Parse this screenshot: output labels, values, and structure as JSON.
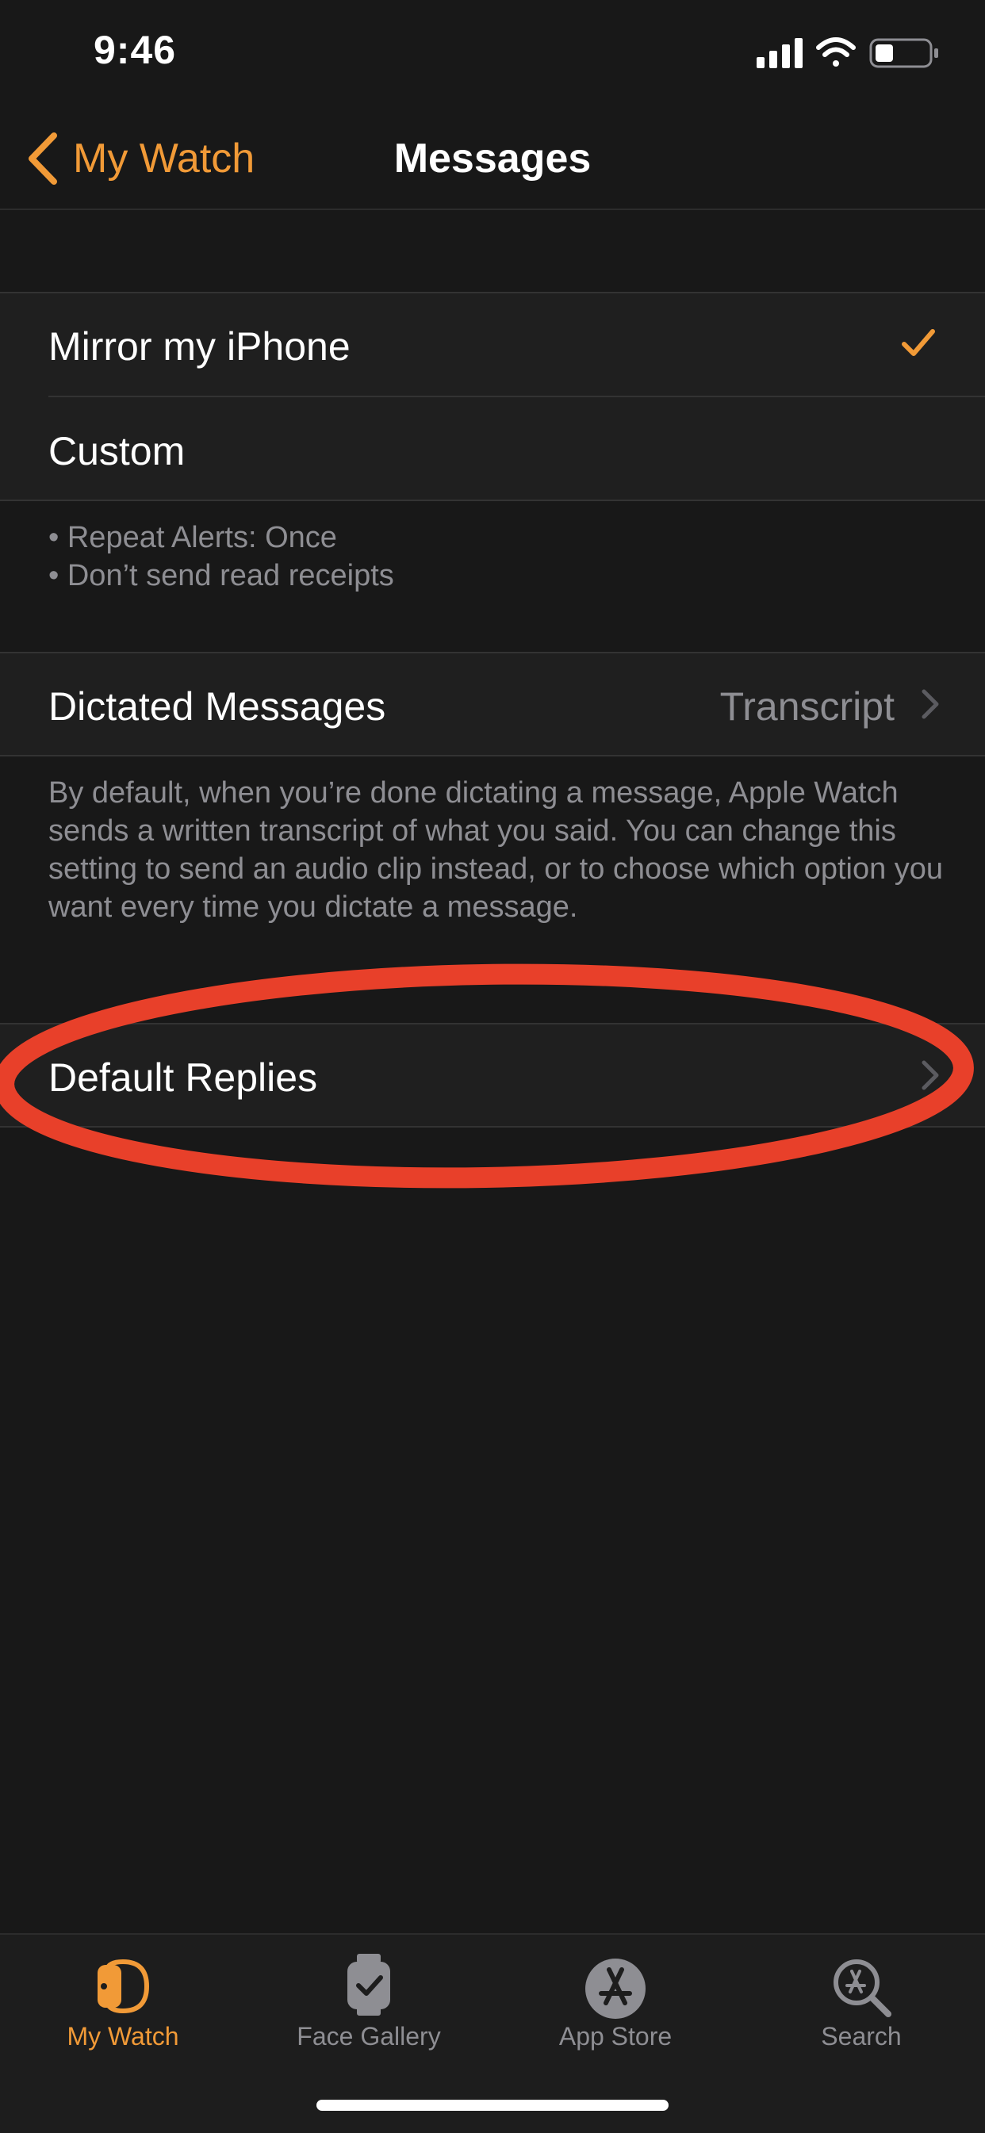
{
  "status": {
    "time": "9:46"
  },
  "nav": {
    "back_label": "My Watch",
    "title": "Messages"
  },
  "mode_options": [
    {
      "label": "Mirror my iPhone",
      "selected": true
    },
    {
      "label": "Custom",
      "selected": false
    }
  ],
  "custom_info": {
    "line1": "• Repeat Alerts: Once",
    "line2": "• Don’t send read receipts"
  },
  "dictated": {
    "label": "Dictated Messages",
    "value": "Transcript",
    "footer": "By default, when you’re done dictating a message, Apple Watch sends a written transcript of what you said. You can change this setting to send an audio clip instead, or to choose which option you want every time you dictate a message."
  },
  "default_replies": {
    "label": "Default Replies"
  },
  "colors": {
    "accent": "#f19a37",
    "annotation": "#e8402a",
    "background": "#181818"
  },
  "tabbar": {
    "tabs": [
      {
        "label": "My Watch",
        "icon": "watch-icon",
        "active": true
      },
      {
        "label": "Face Gallery",
        "icon": "face-gallery-icon",
        "active": false
      },
      {
        "label": "App Store",
        "icon": "app-store-icon",
        "active": false
      },
      {
        "label": "Search",
        "icon": "search-icon",
        "active": false
      }
    ]
  }
}
